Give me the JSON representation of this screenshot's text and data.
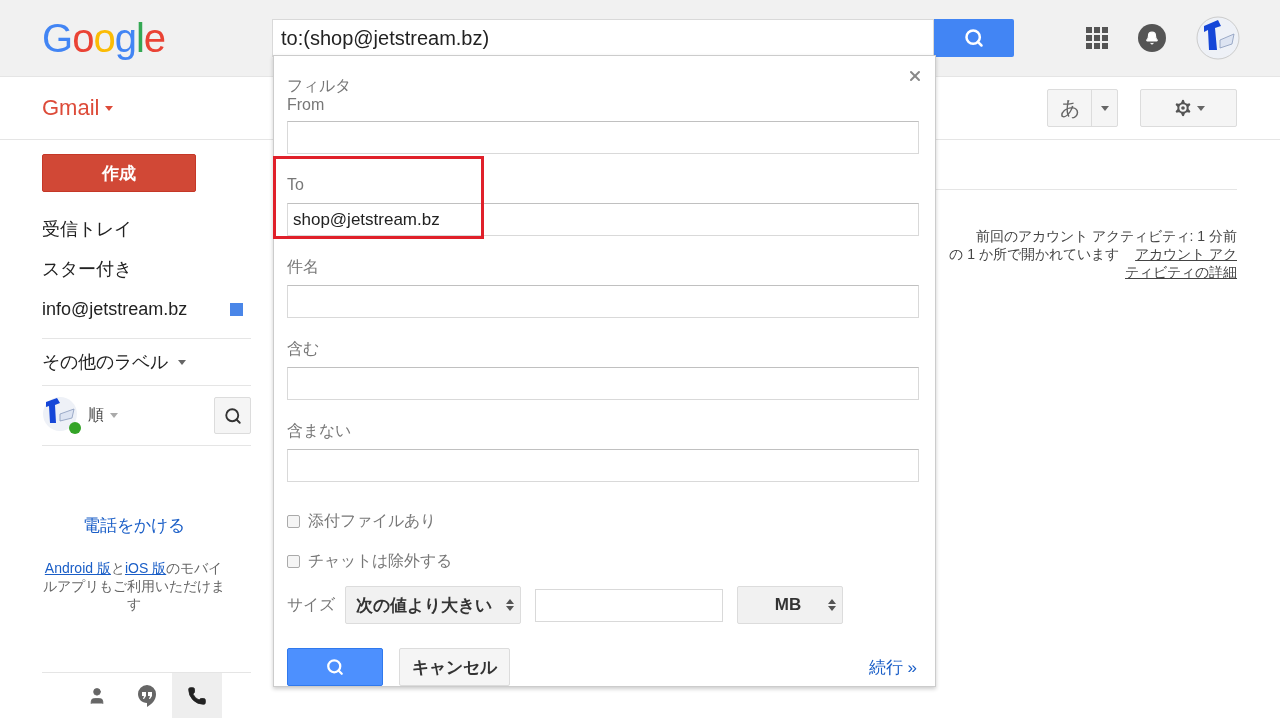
{
  "header": {
    "logo": "Google",
    "search": {
      "value": "to:(shop@jetstream.bz)"
    }
  },
  "toolbar": {
    "app_menu": "Gmail",
    "input_tool": "あ"
  },
  "sidebar": {
    "compose": "作成",
    "items": [
      {
        "label": "受信トレイ"
      },
      {
        "label": "スター付き"
      },
      {
        "label": "info@jetstream.bz",
        "color": "#4a86e8"
      }
    ],
    "more_labels": "その他のラベル",
    "hangouts": {
      "user": "順",
      "online": true
    },
    "call_link": "電話をかける",
    "mobile_note": [
      {
        "text": "Android 版",
        "link": true
      },
      {
        "text": "と",
        "link": false
      },
      {
        "text": "iOS 版",
        "link": true
      },
      {
        "text": "のモバイルアプリもご利用いただけます",
        "link": false
      }
    ],
    "bottom_tabs": [
      {
        "kind": "contacts",
        "selected": false
      },
      {
        "kind": "hangouts",
        "selected": false
      },
      {
        "kind": "phone",
        "selected": true
      }
    ]
  },
  "activity": {
    "last": "前回のアカウント アクティビティ: 1 分前",
    "open": "の 1 か所で開かれています",
    "details_link": "アカウント アクティビティの詳細"
  },
  "filter_dialog": {
    "title": "フィルタ",
    "fields": [
      {
        "label": "From",
        "highlighted": false
      },
      {
        "label": "To",
        "value": "shop@jetstream.bz",
        "highlighted": true
      },
      {
        "label": "件名",
        "highlighted": false
      },
      {
        "label": "含む",
        "highlighted": false
      },
      {
        "label": "含まない",
        "highlighted": false
      }
    ],
    "checkboxes": [
      {
        "label": "添付ファイルあり",
        "checked": false
      },
      {
        "label": "チャットは除外する",
        "checked": false
      }
    ],
    "size": {
      "label": "サイズ",
      "comparison": "次の値より大きい",
      "unit": "MB"
    },
    "cancel": "キャンセル",
    "more": "続行 »"
  }
}
